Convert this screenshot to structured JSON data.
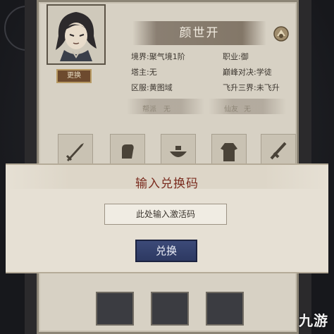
{
  "character": {
    "name": "颜世开",
    "change_label": "更换"
  },
  "info": {
    "realm": "境界:聚气境1阶",
    "job": "职业:御",
    "tower": "塔主:无",
    "peak": "巅峰对决:学徒",
    "region": "区服:黄图域",
    "ascend": "飞升三界:未飞升"
  },
  "slots": {
    "left_label": "帮派",
    "left_value": "无",
    "right_label": "仙友",
    "right_value": "无"
  },
  "dialog": {
    "title": "输入兑换码",
    "placeholder": "此处输入激活码",
    "button_label": "兑换"
  },
  "watermark": "九游",
  "icons": [
    "portrait-icon",
    "badge-icon",
    "sword-icon",
    "fist-icon",
    "bowl-icon",
    "robe-icon",
    "blade-icon",
    "staff-icon"
  ]
}
